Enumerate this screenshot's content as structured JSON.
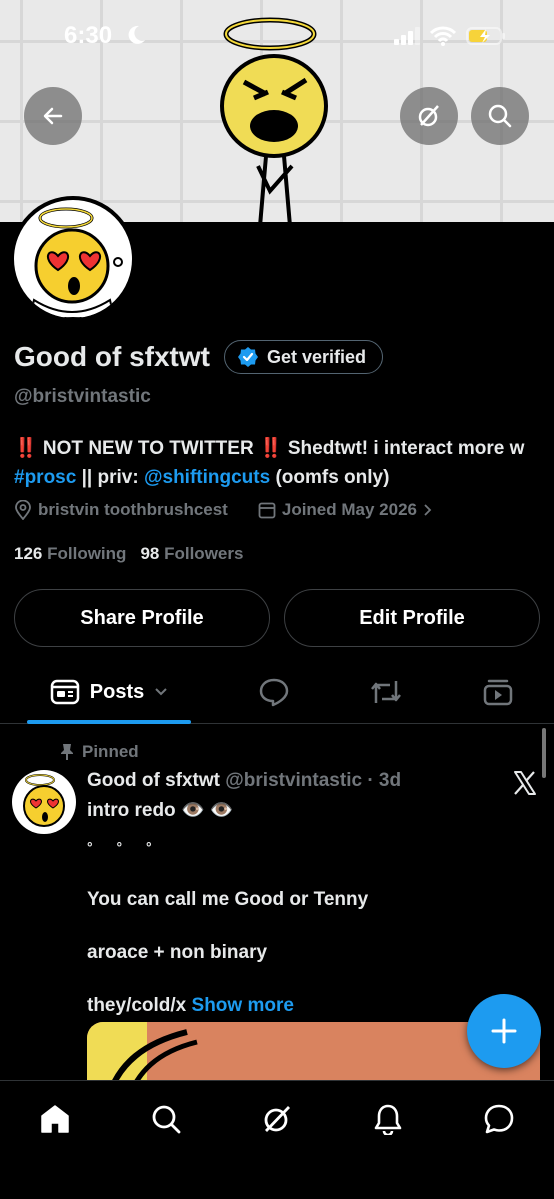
{
  "status_bar": {
    "time": "6:30"
  },
  "profile": {
    "display_name": "Good of sfxtwt",
    "get_verified_label": "Get verified",
    "handle": "@bristvintastic",
    "bio_part1": "‼️ NOT NEW TO TWITTER ‼️ Shedtwt! i interact more w ",
    "bio_hashtag": "#prosc",
    "bio_part2": " || priv: ",
    "bio_mention": "@shiftingcuts",
    "bio_part3": " (oomfs only)",
    "location": "bristvin toothbrushcest",
    "joined": "Joined May 2026",
    "following_count": "126",
    "following_label": "Following",
    "followers_count": "98",
    "followers_label": "Followers"
  },
  "buttons": {
    "share_profile": "Share Profile",
    "edit_profile": "Edit Profile"
  },
  "tabs": {
    "posts_label": "Posts"
  },
  "post": {
    "pinned_label": "Pinned",
    "author": "Good of sfxtwt",
    "meta": "@bristvintastic · 3d",
    "line1": "intro redo 👁️ 👁️",
    "line2": "° ° °",
    "line3": "You can call me Good or Tenny",
    "line4": "aroace + non binary",
    "line5": "they/cold/x",
    "show_more": "Show more"
  },
  "colors": {
    "accent": "#1d9bf0",
    "background": "#000000",
    "muted": "#71767b"
  },
  "icons": [
    "back-arrow-icon",
    "grok-icon",
    "search-icon",
    "verified-badge-icon",
    "location-icon",
    "calendar-icon",
    "chevron-right-icon",
    "posts-tab-icon",
    "chevron-down-icon",
    "replies-icon",
    "reposts-icon",
    "media-icon",
    "pin-icon",
    "x-logo-icon",
    "plus-icon",
    "home-icon",
    "notifications-icon",
    "messages-icon"
  ]
}
